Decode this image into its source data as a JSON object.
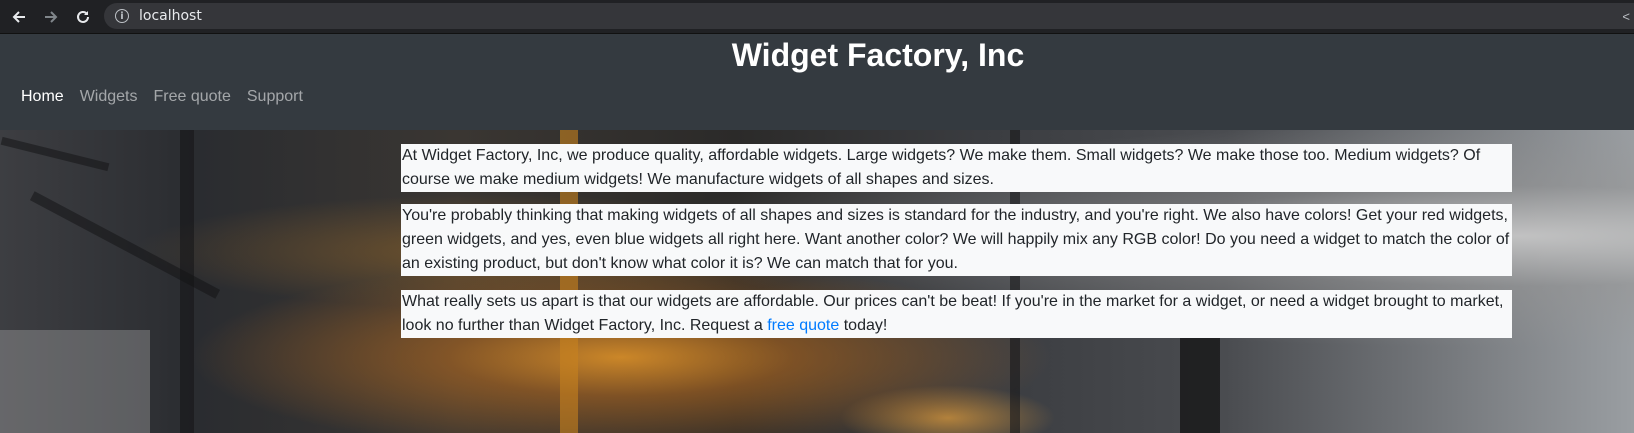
{
  "browser": {
    "url": "localhost"
  },
  "site": {
    "title": "Widget Factory, Inc",
    "nav": [
      {
        "label": "Home",
        "active": true
      },
      {
        "label": "Widgets",
        "active": false
      },
      {
        "label": "Free quote",
        "active": false
      },
      {
        "label": "Support",
        "active": false
      }
    ]
  },
  "content": {
    "paragraph1": "At Widget Factory, Inc, we produce quality, affordable widgets. Large widgets? We make them. Small widgets? We make those too. Medium widgets? Of course we make medium widgets! We manufacture widgets of all shapes and sizes.",
    "paragraph2": "You're probably thinking that making widgets of all shapes and sizes is standard for the industry, and you're right. We also have colors! Get your red widgets, green widgets, and yes, even blue widgets all right here. Want another color? We will happily mix any RGB color! Do you need a widget to match the color of an existing product, but don't know what color it is? We can match that for you.",
    "paragraph3_before": "What really sets us apart is that our widgets are affordable. Our prices can't be beat! If you're in the market for a widget, or need a widget brought to market, look no further than Widget Factory, Inc. Request a ",
    "paragraph3_link": "free quote",
    "paragraph3_after": " today!"
  },
  "colors": {
    "header_bg": "#343a40",
    "link": "#007bff",
    "content_bg": "#f8f9fa"
  }
}
